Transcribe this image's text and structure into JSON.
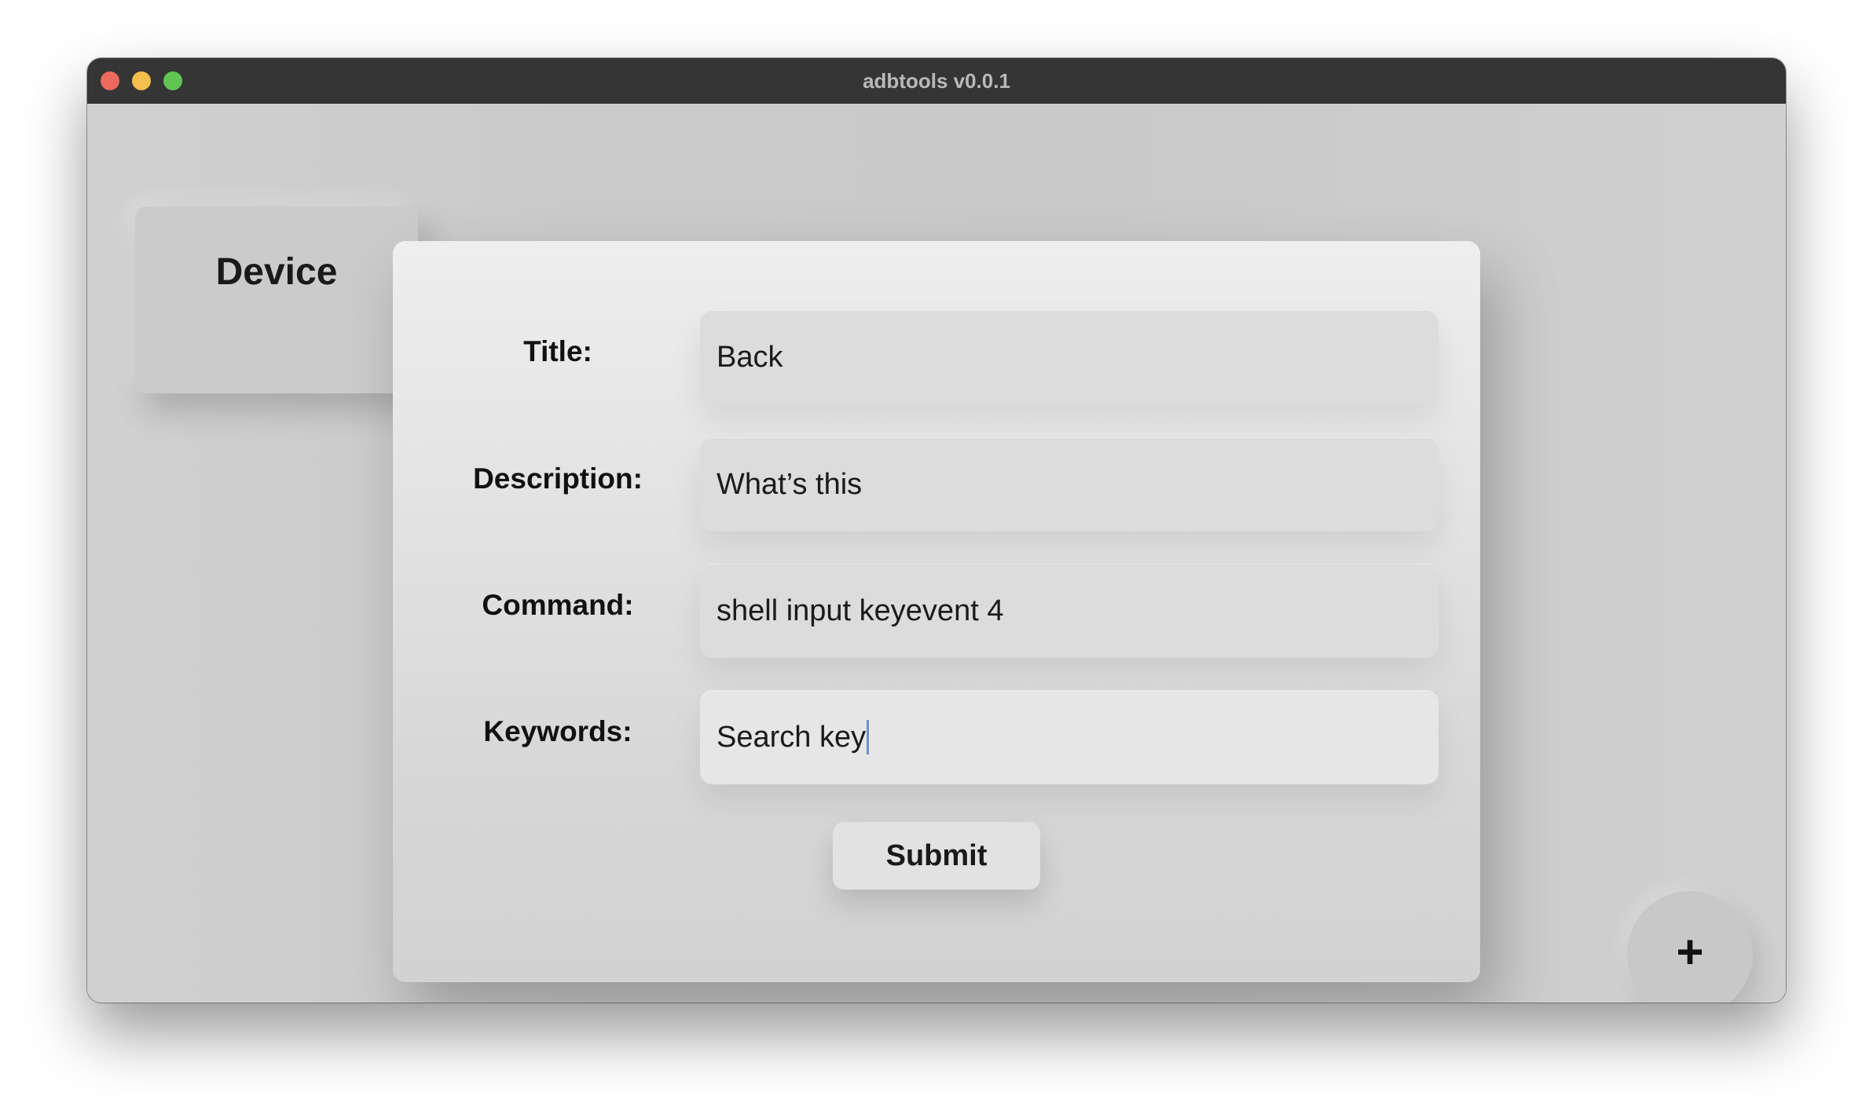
{
  "window": {
    "title": "adbtools v0.0.1"
  },
  "sidebar": {
    "device_label": "Device"
  },
  "form": {
    "fields": [
      {
        "label": "Title:",
        "value": "Back"
      },
      {
        "label": "Description:",
        "value": "What’s this"
      },
      {
        "label": "Command:",
        "value": "shell input keyevent 4"
      },
      {
        "label": "Keywords:",
        "value": "Search key"
      }
    ],
    "submit_label": "Submit"
  },
  "fab": {
    "label": "+",
    "icon": "plus-icon"
  },
  "colors": {
    "titlebar": "#353535",
    "close": "#ed6a5e",
    "minimize": "#f4bf4f",
    "maximize": "#61c554",
    "caret": "#6b8fd6"
  }
}
